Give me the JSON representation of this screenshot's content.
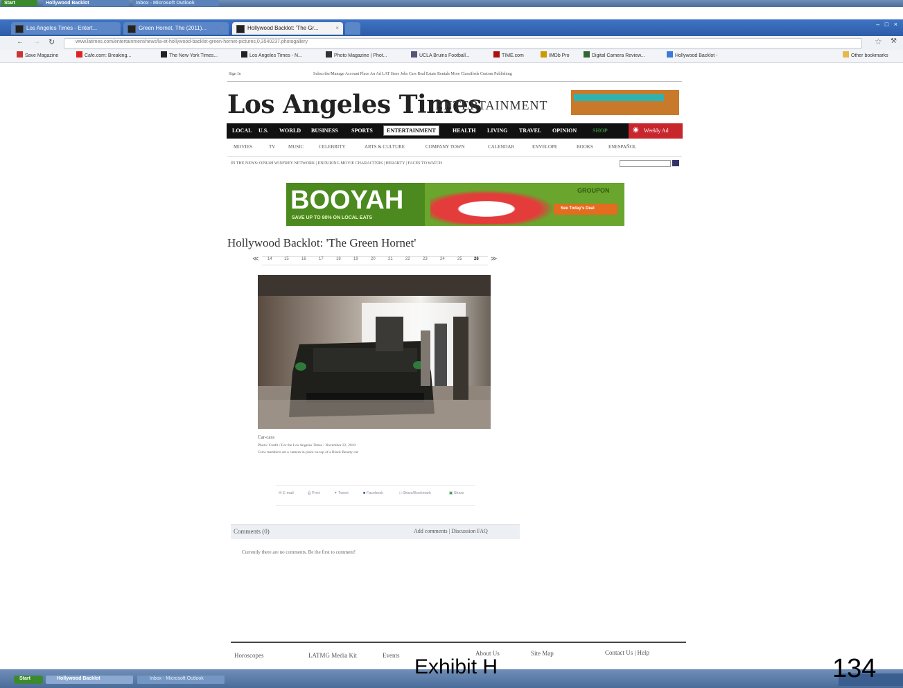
{
  "taskbar_top": {
    "start_label": "Start",
    "items": [
      "Hollywood Backlot",
      "Inbox - Microsoft Outlook"
    ]
  },
  "browser": {
    "tabs": [
      {
        "label": "Los Angeles Times - Entert...",
        "active": false
      },
      {
        "label": "Green Hornet, The (2011)...",
        "active": false
      },
      {
        "label": "Hollywood Backlot: 'The Gr...",
        "active": true
      }
    ],
    "url": "www.latimes.com/entertainment/news/la-et-hollywood-backlot-green-hornet-pictures,0,3540237.photogallery",
    "bookmarks": [
      "Save Magazine",
      "Cafe.com: Breaking...",
      "The New York Times...",
      "Los Angeles Times - N...",
      "Photo Magazine | Phot...",
      "UCLA Bruins Football...",
      "TIME.com",
      "IMDb Pro",
      "Digital Camera Review...",
      "Hollywood Backlot -",
      "Other bookmarks"
    ]
  },
  "page": {
    "signin": "Sign In",
    "toplinks": "Subscribe/Manage Account   Place An Ad   LAT Store   Jobs   Cars   Real Estate   Rentals   More Classifieds   Custom Publishing",
    "logo": "Los Angeles Times",
    "section": "ENTERTAINMENT",
    "nav": [
      "LOCAL",
      "U.S.",
      "WORLD",
      "BUSINESS",
      "SPORTS",
      "ENTERTAINMENT",
      "HEALTH",
      "LIVING",
      "TRAVEL",
      "OPINION",
      "SHOP"
    ],
    "weekly_ad": "Weekly Ad",
    "subnav": [
      "MOVIES",
      "TV",
      "MUSIC",
      "CELEBRITY",
      "ARTS & CULTURE",
      "COMPANY TOWN",
      "CALENDAR",
      "ENVELOPE",
      "BOOKS",
      "ENESPAÑOL"
    ],
    "in_the_news": "IN THE NEWS:  OPRAH WINFREY NETWORK  |  ENDURING MOVIE CHARACTERS  |  HERARTY  |  FACES TO WATCH",
    "ad": {
      "headline": "BOOYAH",
      "subline": "SAVE UP TO 90% ON LOCAL EATS",
      "brand": "GROUPON",
      "cta": "See Today's Deal"
    },
    "title": "Hollywood Backlot: 'The Green Hornet'",
    "pager": [
      "14",
      "15",
      "16",
      "17",
      "18",
      "19",
      "20",
      "21",
      "22",
      "23",
      "24",
      "25",
      "26"
    ],
    "caption_title": "Car-cass",
    "caption_credit": "Photo: Credit / For the Los Angeles Times / November 22, 2010",
    "caption_text": "Crew members set a camera in place on top of a Black Beauty car",
    "share": [
      "E-mail",
      "Print",
      "Tweet",
      "Facebook",
      "Share/Bookmark",
      "Share"
    ],
    "comments_label": "Comments (0)",
    "comments_links": "Add comments | Discussion FAQ",
    "comments_empty": "Currently there are no comments. Be the first to comment!",
    "footer": [
      "Horoscopes",
      "LATMG Media Kit",
      "Events",
      "About Us",
      "Site Map",
      "Contact Us | Help"
    ]
  },
  "taskbar_bottom": {
    "start_label": "Start",
    "items": [
      "Hollywood Backlot",
      "Inbox - Microsoft Outlook"
    ]
  },
  "exhibit_label": "Exhibit H",
  "page_number": "134",
  "colors": {
    "chrome_blue": "#2d5ca8",
    "nav_black": "#111111",
    "groupon_green": "#6aa52d",
    "red_badge": "#c8262d"
  }
}
